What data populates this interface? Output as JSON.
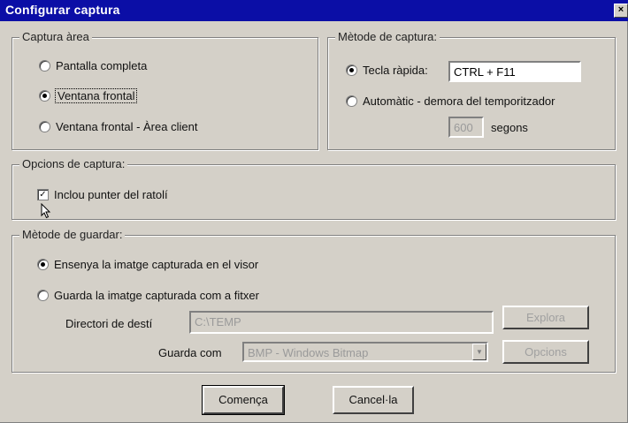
{
  "window": {
    "title": "Configurar captura",
    "close_glyph": "×"
  },
  "area": {
    "legend": "Captura àrea",
    "options": [
      {
        "label": "Pantalla completa",
        "selected": false
      },
      {
        "label": "Ventana frontal",
        "selected": true
      },
      {
        "label": "Ventana frontal - Àrea client",
        "selected": false
      }
    ]
  },
  "method": {
    "legend": "Mètode de captura:",
    "hotkey_label": "Tecla ràpida:",
    "hotkey_value": "CTRL + F11",
    "hotkey_selected": true,
    "timer_label": "Automàtic - demora del temporitzador",
    "timer_selected": false,
    "timer_value": "600",
    "timer_unit": "segons"
  },
  "capture_options": {
    "legend": "Opcions de captura:",
    "include_pointer_label": "Inclou punter del ratolí",
    "include_pointer_checked": true,
    "check_glyph": "✓"
  },
  "save": {
    "legend": "Mètode de guardar:",
    "options": [
      {
        "label": "Ensenya la imatge capturada en el visor",
        "selected": true
      },
      {
        "label": "Guarda la imatge capturada com a fitxer",
        "selected": false
      }
    ],
    "dest_label": "Directori de destí",
    "dest_value": "C:\\TEMP",
    "browse_label": "Explora",
    "saveas_label": "Guarda com",
    "saveas_value": "BMP - Windows Bitmap",
    "options_label": "Opcions"
  },
  "buttons": {
    "start": "Comença",
    "cancel": "Cancel·la"
  },
  "icons": {
    "pointer": "mouse-pointer-icon",
    "dropdown": "chevron-down-icon"
  }
}
